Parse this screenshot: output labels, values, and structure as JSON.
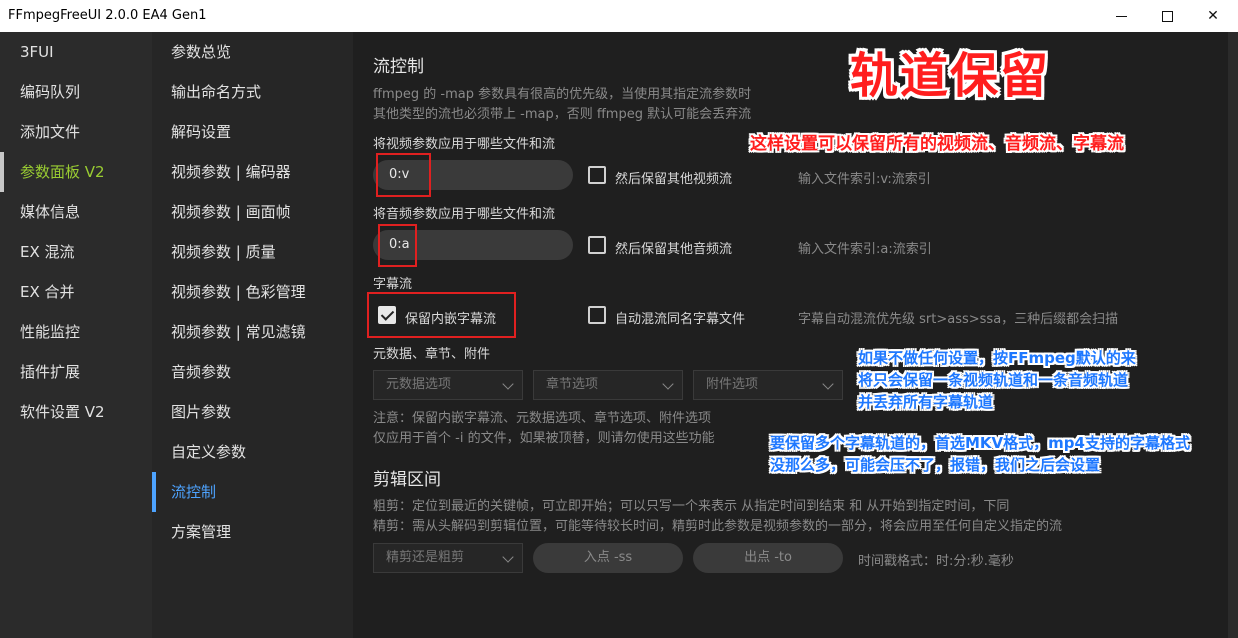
{
  "window": {
    "title": "FFmpegFreeUI 2.0.0 EA4 Gen1"
  },
  "nav_main": [
    "3FUI",
    "编码队列",
    "添加文件",
    "参数面板 V2",
    "媒体信息",
    "EX 混流",
    "EX 合并",
    "性能监控",
    "插件扩展",
    "软件设置 V2"
  ],
  "nav_main_active": "参数面板 V2",
  "nav_sub": [
    "参数总览",
    "输出命名方式",
    "解码设置",
    "视频参数 | 编码器",
    "视频参数 | 画面帧",
    "视频参数 | 质量",
    "视频参数 | 色彩管理",
    "视频参数 | 常见滤镜",
    "音频参数",
    "图片参数",
    "自定义参数",
    "流控制",
    "方案管理"
  ],
  "nav_sub_active": "流控制",
  "stream": {
    "heading": "流控制",
    "desc_line1": "ffmpeg 的 -map 参数具有很高的优先级，当使用其指定流参数时",
    "desc_line2": "其他类型的流也必须带上 -map，否则 ffmpeg 默认可能会丢弃流",
    "video_label": "将视频参数应用于哪些文件和流",
    "video_value": "0:v",
    "video_keep_label": "然后保留其他视频流",
    "video_keep_checked": false,
    "video_hint": "输入文件索引:v:流索引",
    "audio_label": "将音频参数应用于哪些文件和流",
    "audio_value": "0:a",
    "audio_keep_label": "然后保留其他音频流",
    "audio_keep_checked": false,
    "audio_hint": "输入文件索引:a:流索引",
    "subtitle_label": "字幕流",
    "keep_embedded_label": "保留内嵌字幕流",
    "keep_embedded_checked": true,
    "auto_mux_label": "自动混流同名字幕文件",
    "auto_mux_checked": false,
    "subtitle_hint": "字幕自动混流优先级 srt>ass>ssa，三种后缀都会扫描",
    "meta_label": "元数据、章节、附件",
    "meta_dropdown": "元数据选项",
    "chapter_dropdown": "章节选项",
    "attach_dropdown": "附件选项",
    "note_line1": "注意：保留内嵌字幕流、元数据选项、章节选项、附件选项",
    "note_line2": "仅应用于首个 -i 的文件，如果被顶替，则请勿使用这些功能"
  },
  "clip": {
    "heading": "剪辑区间",
    "desc_line1": "粗剪：定位到最近的关键帧，可立即开始；可以只写一个来表示 从指定时间到结束 和 从开始到指定时间，下同",
    "desc_line2": "精剪：需从头解码到剪辑位置，可能等待较长时间，精剪时此参数是视频参数的一部分，将会应用至任何自定义指定的流",
    "mode_dropdown": "精剪还是粗剪",
    "in_placeholder": "入点 -ss",
    "out_placeholder": "出点 -to",
    "time_format": "时间戳格式：时:分:秒.毫秒"
  },
  "annotations": {
    "big_title": "轨道保留",
    "red_note": "这样设置可以保留所有的视频流、音频流、字幕流",
    "blue1_line1": "如果不做任何设置，按FFmpeg默认的来",
    "blue1_line2": "将只会保留一条视频轨道和一条音频轨道",
    "blue1_line3": "并丢弃所有字幕轨道",
    "blue2_line1": "要保留多个字幕轨道的，首选MKV格式，mp4支持的字幕格式",
    "blue2_line2": "没那么多，可能会压不了，报错，我们之后会设置"
  },
  "colors": {
    "accent_main": "#9acd32",
    "accent_sub": "#4da3ff",
    "annotation_red": "#ff1e1e",
    "annotation_blue": "#1e78ff"
  }
}
